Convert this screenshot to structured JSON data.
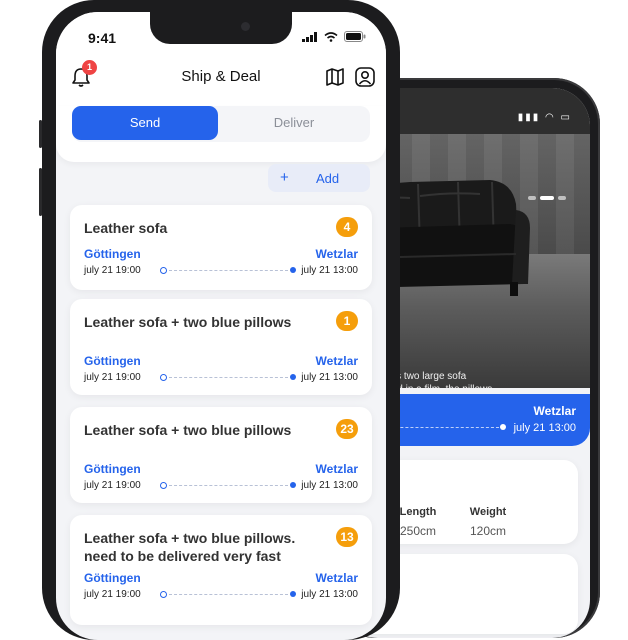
{
  "back_screen": {
    "caption": "sofa. includes two large sofa\n will be packed in a film, the pillows\nd separately.",
    "route": {
      "destination": "Wetzlar",
      "time": "july 21 13:00"
    },
    "dimensions": {
      "title": "sions",
      "columns": [
        {
          "label": "ght",
          "value": "cm"
        },
        {
          "label": "Length",
          "value": "250cm"
        },
        {
          "label": "Weight",
          "value": "120cm"
        }
      ]
    }
  },
  "status_bar": {
    "time": "9:41"
  },
  "header": {
    "title": "Ship & Deal",
    "notification_count": "1"
  },
  "segment": {
    "send_label": "Send",
    "deliver_label": "Deliver"
  },
  "add_button": {
    "plus": "+",
    "label": "Add"
  },
  "shipments": [
    {
      "name": "Leather sofa",
      "count": "4",
      "from": "Göttingen",
      "to": "Wetzlar",
      "depart": "july 21 19:00",
      "arrive": "july 21 13:00"
    },
    {
      "name": "Leather sofa + two blue pillows",
      "count": "1",
      "from": "Göttingen",
      "to": "Wetzlar",
      "depart": "july 21 19:00",
      "arrive": "july 21 13:00"
    },
    {
      "name": "Leather sofa + two blue pillows",
      "count": "23",
      "from": "Göttingen",
      "to": "Wetzlar",
      "depart": "july 21 19:00",
      "arrive": "july 21 13:00"
    },
    {
      "name": "Leather sofa + two blue pillows. need to be delivered very fast",
      "count": "13",
      "from": "Göttingen",
      "to": "Wetzlar",
      "depart": "july 21 19:00",
      "arrive": "july 21 13:00"
    }
  ],
  "colors": {
    "accent": "#2563eb",
    "badge": "#f59e0b",
    "notification": "#ef4444"
  }
}
